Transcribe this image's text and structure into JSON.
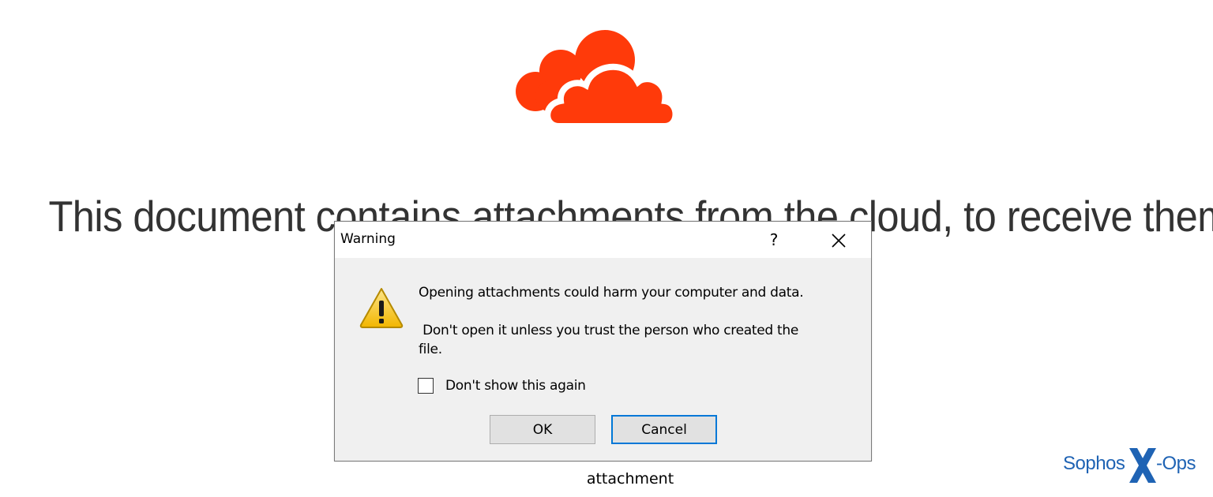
{
  "document": {
    "text": "This document contains attachments from the cloud, to receive them,"
  },
  "dialog": {
    "title": "Warning",
    "help_label": "?",
    "message_primary": "Opening attachments could harm your computer and data.",
    "message_secondary": " Don't open it unless you trust the person who created the\nfile.",
    "checkbox_label": "Don't show this again",
    "checkbox_checked": false,
    "ok_label": "OK",
    "cancel_label": "Cancel"
  },
  "caption": "attachment",
  "brand": {
    "name_left": "Sophos",
    "name_right": "-Ops"
  },
  "colors": {
    "cloud": "#ff3a0a",
    "brand": "#1f63b4",
    "accent": "#0078d7"
  },
  "icons": {
    "logo": "cloud-icon",
    "warning": "warning-icon",
    "close": "close-icon"
  }
}
